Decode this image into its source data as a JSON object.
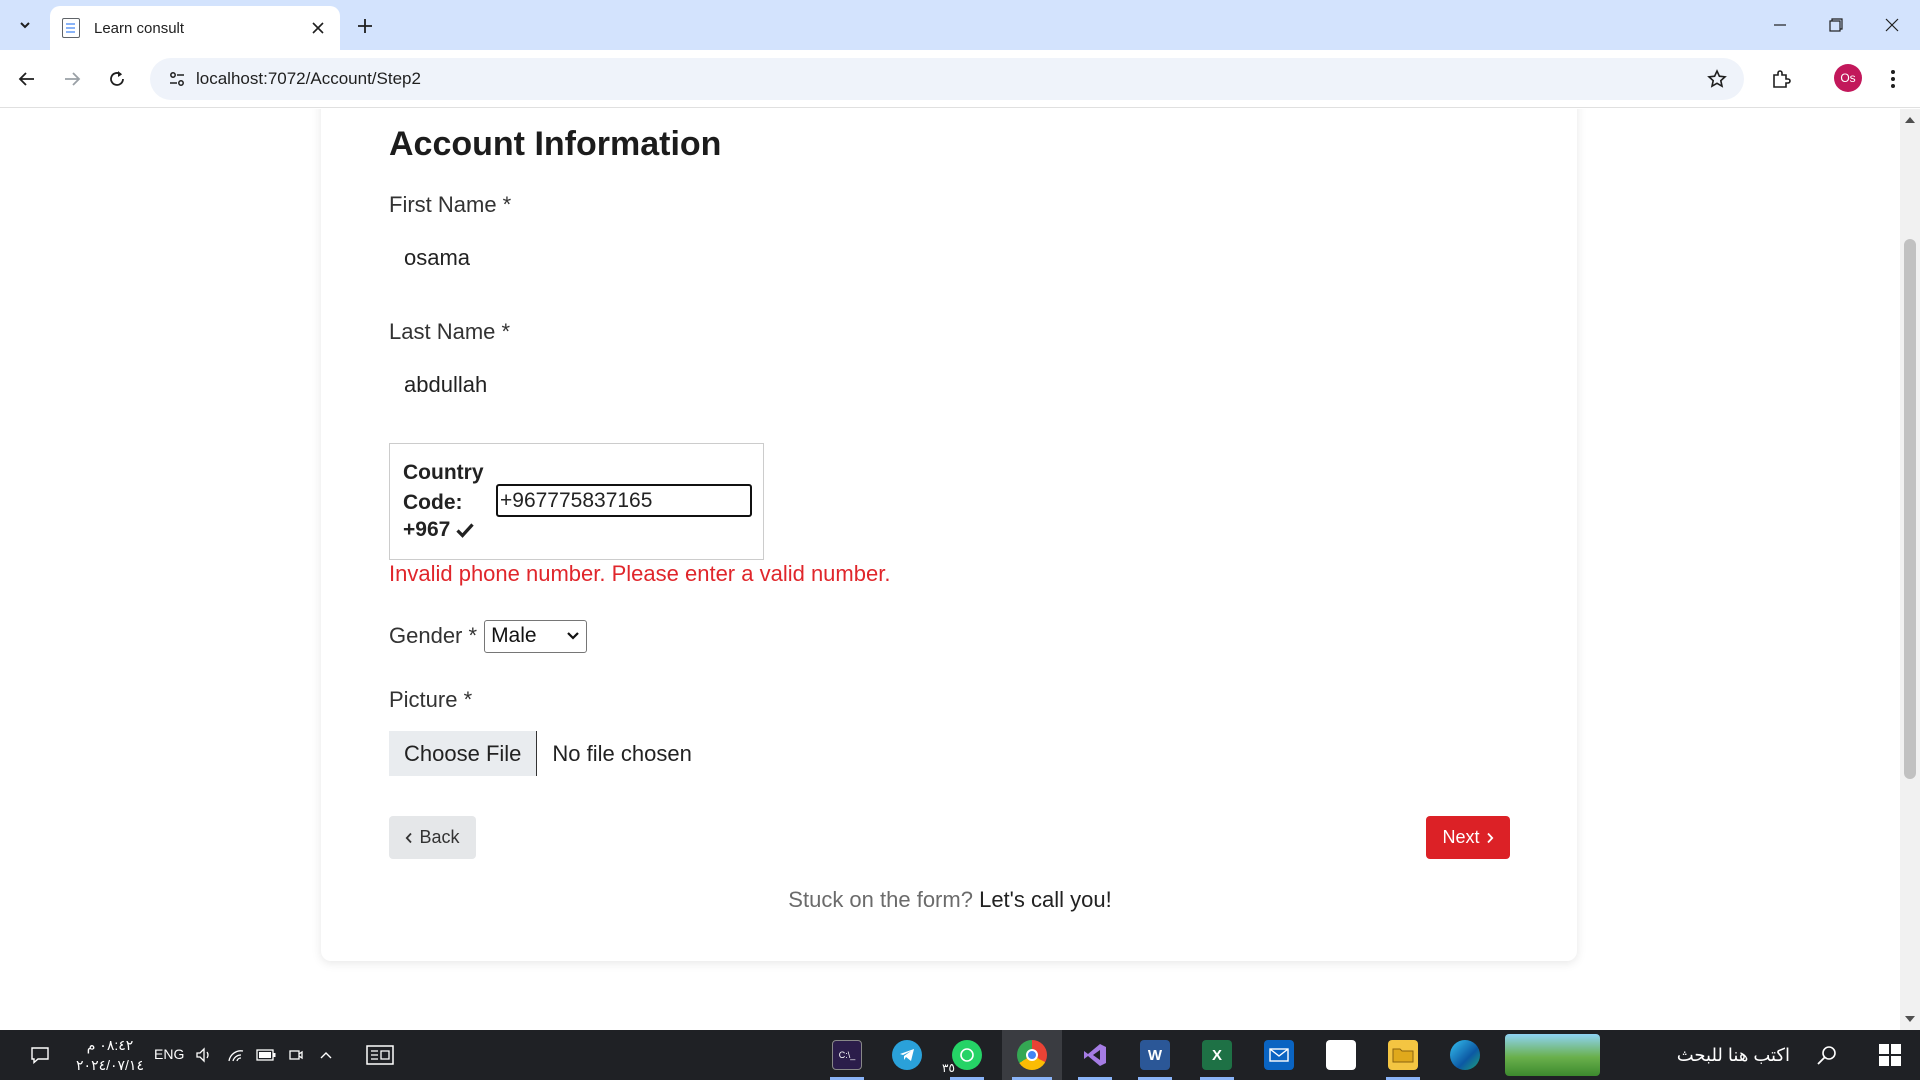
{
  "browser": {
    "tab_title": "Learn consult",
    "url": "localhost:7072/Account/Step2",
    "profile_initials": "Os"
  },
  "form": {
    "heading": "Account Information",
    "first_name_label": "First Name *",
    "first_name_value": "osama",
    "last_name_label": "Last Name *",
    "last_name_value": "abdullah",
    "country_code_label": "Country Code:",
    "country_code_value": "+967",
    "phone_value": "+967775837165",
    "error_message": "Invalid phone number. Please enter a valid number.",
    "gender_label": "Gender *",
    "gender_selected": "Male",
    "picture_label": "Picture *",
    "choose_file_label": "Choose File",
    "no_file_text": "No file chosen",
    "back_label": "Back",
    "next_label": "Next",
    "stuck_text": "Stuck on the form?",
    "call_link": "Let's call you!"
  },
  "taskbar": {
    "time": "٠٨:٤٢ م",
    "date": "٢٠٢٤/٠٧/١٤",
    "language": "ENG",
    "search_placeholder": "اكتب هنا للبحث",
    "whatsapp_badge": "٣٥"
  },
  "colors": {
    "accent_red": "#dc2126",
    "error_red": "#e0262b",
    "tabstrip": "#d3e3fd",
    "taskbar": "#1f2125"
  }
}
